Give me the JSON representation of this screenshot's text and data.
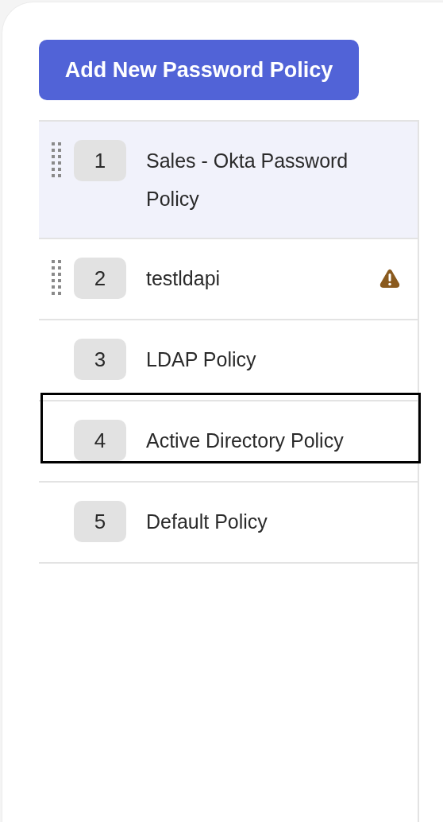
{
  "add_button": {
    "label": "Add New Password Policy"
  },
  "policies": [
    {
      "number": "1",
      "name": "Sales - Okta Password Policy",
      "selected": true,
      "draggable": true,
      "warning": false,
      "focused": false
    },
    {
      "number": "2",
      "name": "testldapi",
      "selected": false,
      "draggable": true,
      "warning": true,
      "focused": false
    },
    {
      "number": "3",
      "name": "LDAP Policy",
      "selected": false,
      "draggable": false,
      "warning": false,
      "focused": false
    },
    {
      "number": "4",
      "name": "Active Directory Policy",
      "selected": false,
      "draggable": false,
      "warning": false,
      "focused": true
    },
    {
      "number": "5",
      "name": "Default Policy",
      "selected": false,
      "draggable": false,
      "warning": false,
      "focused": false
    }
  ]
}
